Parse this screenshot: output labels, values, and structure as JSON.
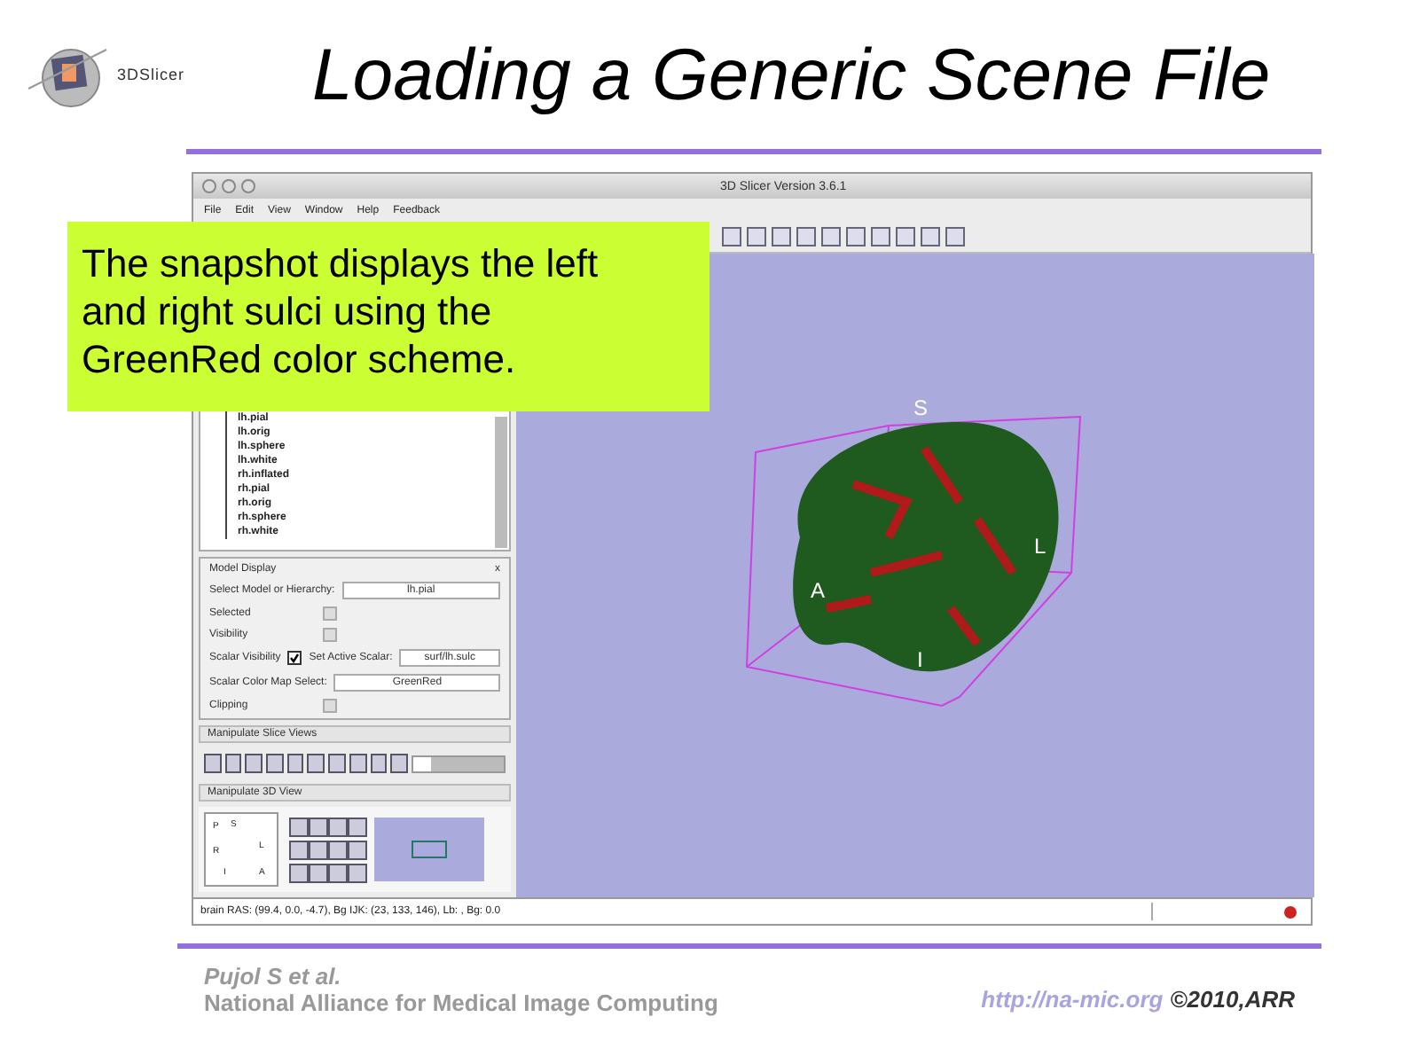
{
  "logo": {
    "text": "3DSlicer"
  },
  "title": "Loading a Generic Scene File",
  "app": {
    "window_title": "3D Slicer Version 3.6.1",
    "menu": [
      "File",
      "Edit",
      "View",
      "Window",
      "Help",
      "Feedback"
    ],
    "model_tree": [
      "lh.pial",
      "lh.orig",
      "lh.sphere",
      "lh.white",
      "rh.inflated",
      "rh.pial",
      "rh.orig",
      "rh.sphere",
      "rh.white"
    ],
    "model_display": {
      "title": "Model Display",
      "close": "x",
      "rows": [
        {
          "kind": "field",
          "label": "Select Model or Hierarchy:",
          "value": "lh.pial"
        },
        {
          "kind": "checkbox",
          "label": "Selected",
          "checked": false
        },
        {
          "kind": "checkbox",
          "label": "Visibility",
          "checked": false
        },
        {
          "kind": "scalar",
          "label": "Scalar Visibility",
          "checked": true,
          "label_2": "Set Active Scalar:",
          "value": "surf/lh.sulc"
        },
        {
          "kind": "spinner",
          "label": "Scalar Color Map Select:",
          "value": "GreenRed"
        },
        {
          "kind": "checkbox",
          "label": "Clipping",
          "checked": false
        }
      ]
    },
    "slice_views": {
      "title": "Manipulate Slice Views",
      "level": 0.2
    },
    "view_3d_panel": {
      "title": "Manipulate 3D View",
      "compass": [
        "P",
        "S",
        "L",
        "R",
        "I",
        "A"
      ]
    },
    "view_labels": [
      "S",
      "L",
      "A",
      "I"
    ],
    "status_bar": "brain RAS: (99.4, 0.0, -4.7), Bg IJK: (23, 133, 146), Lb: , Bg: 0.0"
  },
  "callout": "The snapshot displays the left and right sulci using the GreenRed color scheme.",
  "footer": {
    "author": "Pujol S et al.",
    "org": "National Alliance for Medical Image Computing",
    "url": "http://na-mic.org",
    "copyright": "©2010,ARR"
  }
}
